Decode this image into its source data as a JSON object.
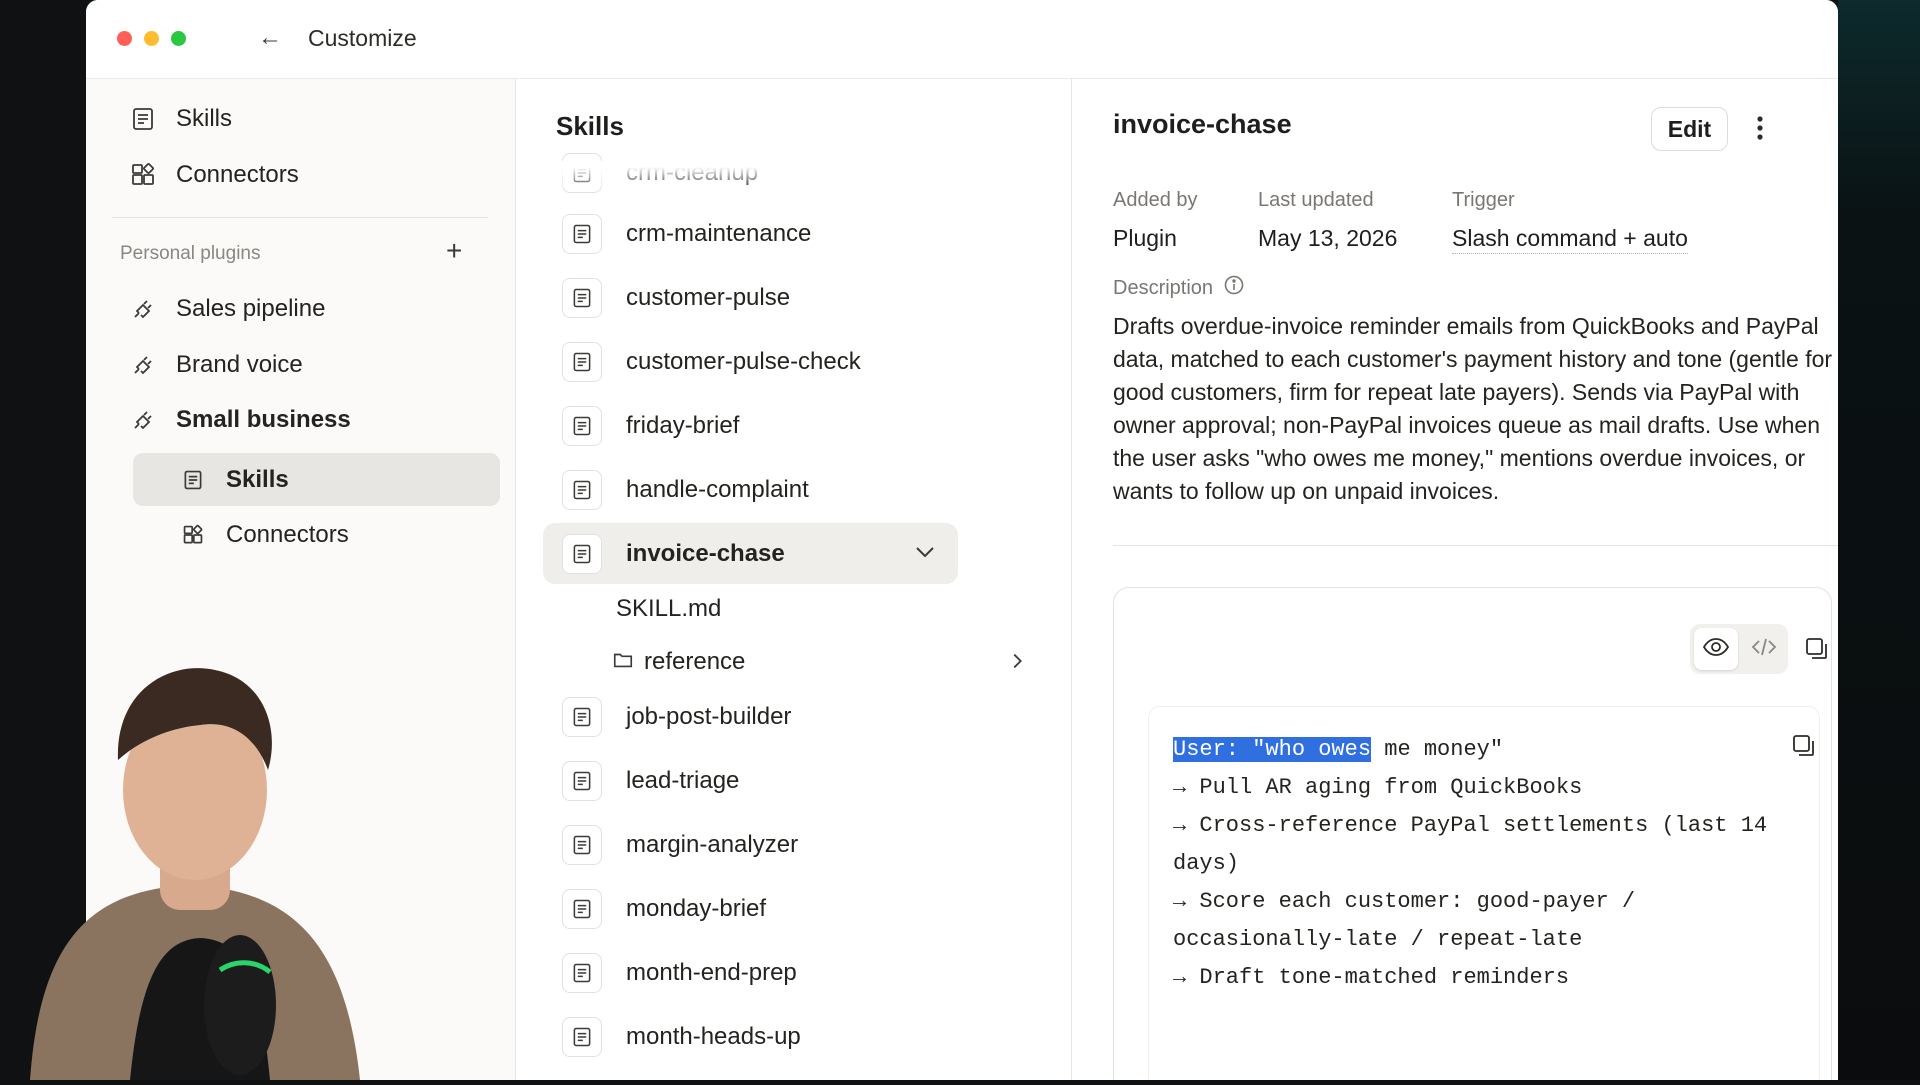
{
  "window": {
    "title": "Customize"
  },
  "sidebar": {
    "top_items": [
      {
        "label": "Skills"
      },
      {
        "label": "Connectors"
      }
    ],
    "section_label": "Personal plugins",
    "plugins": [
      {
        "label": "Sales pipeline"
      },
      {
        "label": "Brand voice"
      },
      {
        "label": "Small business"
      }
    ],
    "sub_items": [
      {
        "label": "Skills"
      },
      {
        "label": "Connectors"
      }
    ]
  },
  "list": {
    "title": "Skills",
    "items": [
      {
        "label": "crm-cleanup"
      },
      {
        "label": "crm-maintenance"
      },
      {
        "label": "customer-pulse"
      },
      {
        "label": "customer-pulse-check"
      },
      {
        "label": "friday-brief"
      },
      {
        "label": "handle-complaint"
      },
      {
        "label": "invoice-chase"
      },
      {
        "label": "job-post-builder"
      },
      {
        "label": "lead-triage"
      },
      {
        "label": "margin-analyzer"
      },
      {
        "label": "monday-brief"
      },
      {
        "label": "month-end-prep"
      },
      {
        "label": "month-heads-up"
      }
    ],
    "expanded_children": {
      "file": "SKILL.md",
      "folder": "reference"
    }
  },
  "detail": {
    "title": "invoice-chase",
    "edit_label": "Edit",
    "added_by_label": "Added by",
    "added_by_value": "Plugin",
    "last_updated_label": "Last updated",
    "last_updated_value": "May 13, 2026",
    "trigger_label": "Trigger",
    "trigger_value": "Slash command + auto",
    "description_label": "Description",
    "description": "Drafts overdue-invoice reminder emails from QuickBooks and PayPal data, matched to each customer's payment history and tone (gentle for good customers, firm for repeat late payers). Sends via PayPal with owner approval; non-PayPal invoices queue as mail drafts. Use when the user asks \"who owes me money,\" mentions overdue invoices, or wants to follow up on unpaid invoices."
  },
  "code_preview": {
    "highlighted": "User: \"who owes",
    "line1_rest": " me money\"",
    "lines": [
      "→ Pull AR aging from QuickBooks",
      "→ Cross-reference PayPal settlements (last 14 days)",
      "→ Score each customer: good-payer / occasionally-late / repeat-late",
      "→ Draft tone-matched reminders"
    ]
  },
  "colors": {
    "accent_selection": "#2f6fe0",
    "traffic_red": "#ff5f57",
    "traffic_yellow": "#febc2e",
    "traffic_green": "#28c840"
  }
}
